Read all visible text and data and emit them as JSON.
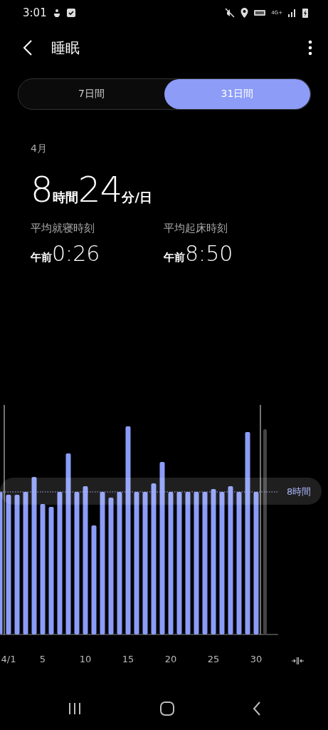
{
  "status_bar": {
    "time": "3:01",
    "network": "4G+"
  },
  "app_bar": {
    "title": "睡眠"
  },
  "tabs": [
    {
      "label": "7日間",
      "selected": false
    },
    {
      "label": "31日間",
      "selected": true
    }
  ],
  "summary": {
    "period": "4月",
    "duration": [
      {
        "value": "8",
        "unit": "時間"
      },
      {
        "value": "24",
        "unit": "分/日"
      }
    ],
    "stats": [
      {
        "label": "平均就寝時刻",
        "prefix": "午前",
        "time": "0:26"
      },
      {
        "label": "平均起床時刻",
        "prefix": "午前",
        "time": "8:50"
      }
    ]
  },
  "chart": {
    "reference_label": "8時間",
    "x_labels": [
      "4/1",
      "5",
      "10",
      "15",
      "20",
      "25",
      "30"
    ]
  }
}
